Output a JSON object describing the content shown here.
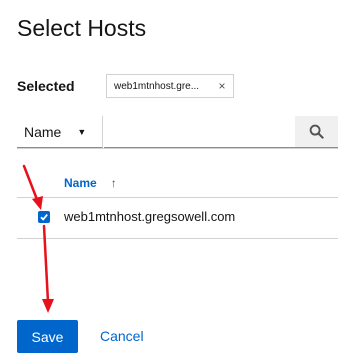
{
  "modal": {
    "title": "Select Hosts"
  },
  "selection": {
    "label": "Selected",
    "chips": [
      {
        "text": "web1mtnhost.gre...",
        "close_icon": "×"
      }
    ]
  },
  "toolbar": {
    "filter_label": "Name",
    "search_placeholder": "",
    "search_icon": "search-icon"
  },
  "table": {
    "columns": [
      {
        "label": "Name",
        "sort_icon": "↑"
      }
    ],
    "rows": [
      {
        "name": "web1mtnhost.gregsowell.com",
        "checked": true
      }
    ]
  },
  "footer": {
    "save_label": "Save",
    "cancel_label": "Cancel"
  },
  "colors": {
    "primary": "#0066cc",
    "annotation": "#e8101a",
    "border": "#d2d2d2"
  }
}
